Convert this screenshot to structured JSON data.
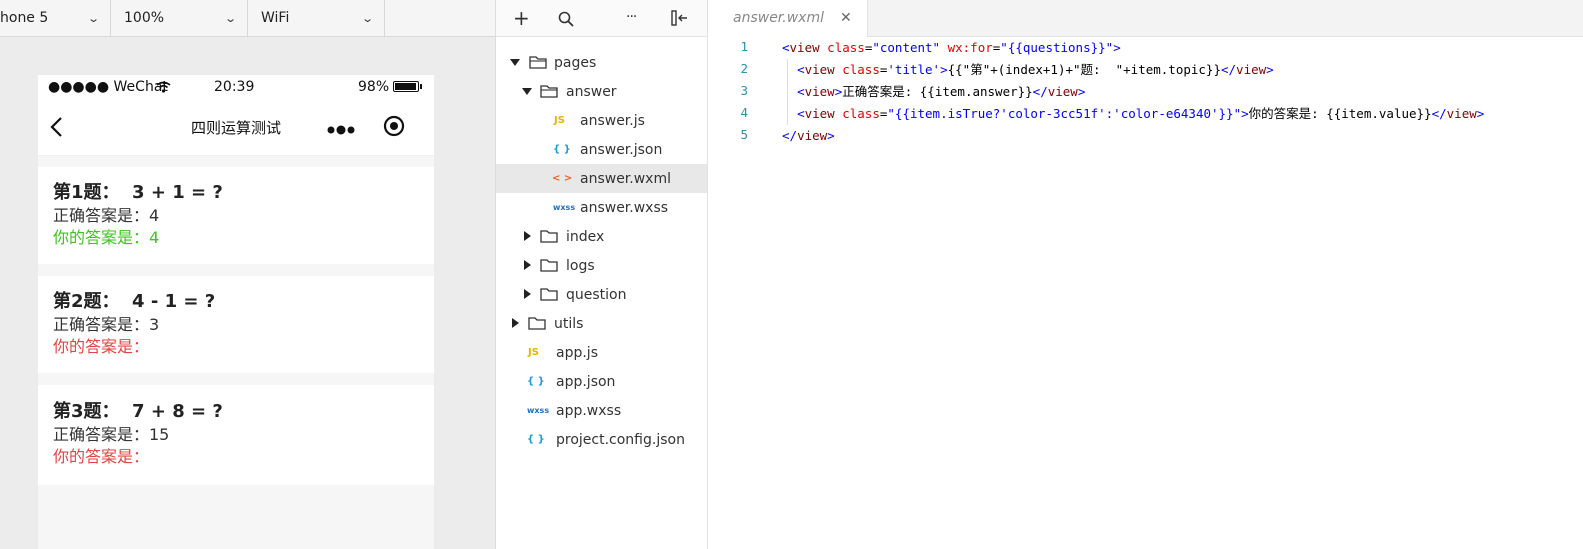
{
  "simulator": {
    "device": "hone 5",
    "zoom": "100%",
    "network": "WiFi"
  },
  "phone": {
    "status": {
      "carrier": "●●●●● WeChat",
      "time": "20:39",
      "battery": "98%"
    },
    "nav_title": "四则运算测试",
    "questions": [
      {
        "title": "第1题：  3 + 1 = ?",
        "answer": "正确答案是：4",
        "user": "你的答案是：4",
        "correct": true
      },
      {
        "title": "第2题：  4 - 1 = ?",
        "answer": "正确答案是：3",
        "user": "你的答案是：",
        "correct": false
      },
      {
        "title": "第3题：  7 + 8 = ?",
        "answer": "正确答案是：15",
        "user": "你的答案是：",
        "correct": false
      }
    ],
    "colors": {
      "correct": "#3cc51f",
      "wrong": "#e64340"
    }
  },
  "filetree": {
    "items": [
      {
        "label": "pages",
        "type": "folder-open"
      },
      {
        "label": "answer",
        "type": "folder-open"
      },
      {
        "label": "answer.js",
        "type": "js",
        "icon_text": "JS"
      },
      {
        "label": "answer.json",
        "type": "json",
        "icon_text": "{ }"
      },
      {
        "label": "answer.wxml",
        "type": "wxml",
        "icon_text": "< >",
        "selected": true
      },
      {
        "label": "answer.wxss",
        "type": "wxss",
        "icon_text": "wxss"
      },
      {
        "label": "index",
        "type": "folder"
      },
      {
        "label": "logs",
        "type": "folder"
      },
      {
        "label": "question",
        "type": "folder"
      },
      {
        "label": "utils",
        "type": "folder"
      },
      {
        "label": "app.js",
        "type": "js",
        "icon_text": "JS"
      },
      {
        "label": "app.json",
        "type": "json",
        "icon_text": "{ }"
      },
      {
        "label": "app.wxss",
        "type": "wxss",
        "icon_text": "wxss"
      },
      {
        "label": "project.config.json",
        "type": "json",
        "icon_text": "{ }"
      }
    ]
  },
  "editor": {
    "tab_label": "answer.wxml",
    "close_glyph": "✕",
    "line_numbers": [
      "1",
      "2",
      "3",
      "4",
      "5"
    ],
    "lines": [
      "<view class=\"content\" wx:for=\"{{questions}}\">",
      "  <view class='title'>{{\"第\"+(index+1)+\"题:  \"+item.topic}}</view>",
      "  <view>正确答案是: {{item.answer}}</view>",
      "  <view class=\"{{item.isTrue?'color-3cc51f':'color-e64340'}}\">你的答案是: {{item.value}}</view>",
      "</view>"
    ]
  }
}
